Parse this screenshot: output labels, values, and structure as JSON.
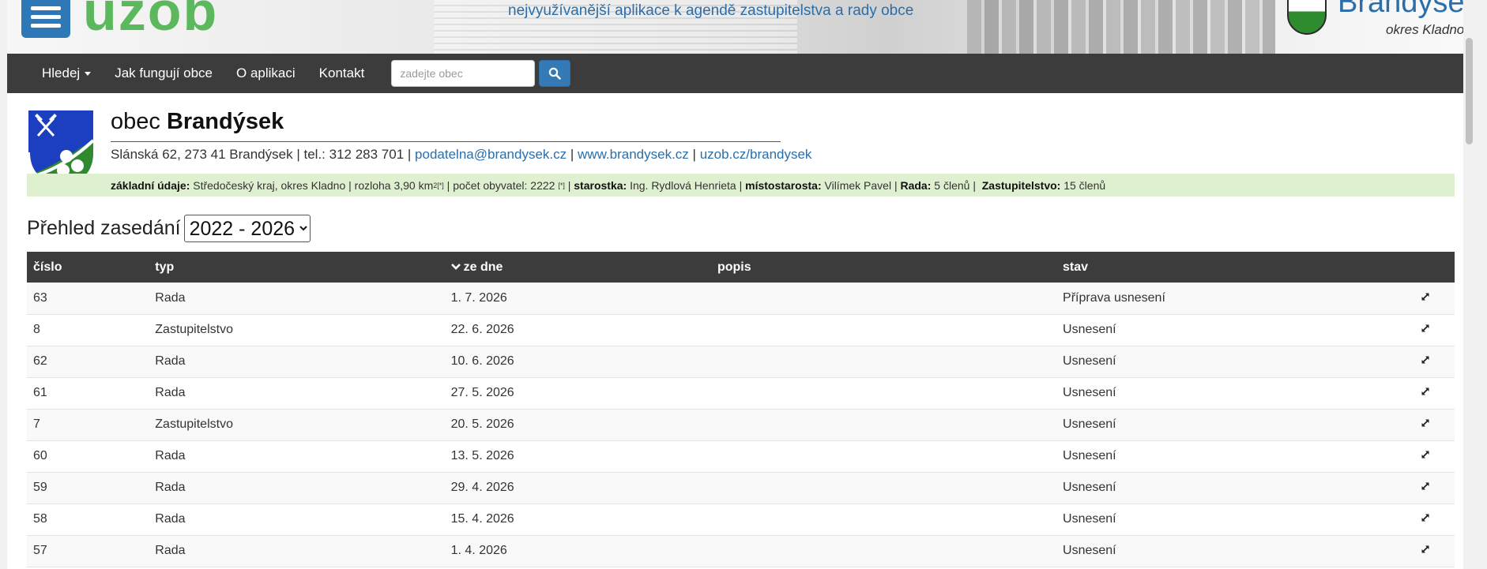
{
  "banner": {
    "logo": "uzob",
    "tagline": "nejvyužívanější aplikace k agendě zastupitelstva a rady obce",
    "municipality_short": "Brandýsek",
    "district": "okres Kladno"
  },
  "navbar": {
    "items": [
      {
        "label": "Hledej",
        "has_dropdown": true
      },
      {
        "label": "Jak fungují obce"
      },
      {
        "label": "O aplikaci"
      },
      {
        "label": "Kontakt"
      }
    ],
    "search_placeholder": "zadejte obec"
  },
  "municipality": {
    "prefix": "obec",
    "name": "Brandýsek",
    "address": "Slánská 62, 273 41 Brandýsek",
    "phone_label": "tel.:",
    "phone": "312 283 701",
    "email": "podatelna@brandysek.cz",
    "web": "www.brandysek.cz",
    "uzob_link": "uzob.cz/brandysek"
  },
  "basic_info": {
    "label": "základní údaje:",
    "region": "Středočeský kraj, okres Kladno",
    "area_label": "rozloha",
    "area": "3,90 km",
    "area_sup": "2[*]",
    "population_label": "počet obyvatel:",
    "population": "2222",
    "population_sup": "[*]",
    "mayor_label": "starostka:",
    "mayor": "Ing. Rydlová Henrieta",
    "deputy_label": "místostarosta:",
    "deputy": "Vilímek Pavel",
    "council_label": "Rada:",
    "council": "5 členů",
    "assembly_label": "Zastupitelstvo:",
    "assembly": "15 členů"
  },
  "overview": {
    "title": "Přehled zasedání",
    "period_selected": "2022 - 2026"
  },
  "table": {
    "headers": {
      "number": "číslo",
      "type": "typ",
      "date": "ze dne",
      "description": "popis",
      "status": "stav"
    },
    "rows": [
      {
        "number": "63",
        "type": "Rada",
        "date": "1. 7. 2026",
        "description": "",
        "status": "Příprava usnesení"
      },
      {
        "number": "8",
        "type": "Zastupitelstvo",
        "date": "22. 6. 2026",
        "description": "",
        "status": "Usnesení"
      },
      {
        "number": "62",
        "type": "Rada",
        "date": "10. 6. 2026",
        "description": "",
        "status": "Usnesení"
      },
      {
        "number": "61",
        "type": "Rada",
        "date": "27. 5. 2026",
        "description": "",
        "status": "Usnesení"
      },
      {
        "number": "7",
        "type": "Zastupitelstvo",
        "date": "20. 5. 2026",
        "description": "",
        "status": "Usnesení"
      },
      {
        "number": "60",
        "type": "Rada",
        "date": "13. 5. 2026",
        "description": "",
        "status": "Usnesení"
      },
      {
        "number": "59",
        "type": "Rada",
        "date": "29. 4. 2026",
        "description": "",
        "status": "Usnesení"
      },
      {
        "number": "58",
        "type": "Rada",
        "date": "15. 4. 2026",
        "description": "",
        "status": "Usnesení"
      },
      {
        "number": "57",
        "type": "Rada",
        "date": "1. 4. 2026",
        "description": "",
        "status": "Usnesení"
      }
    ]
  },
  "icons": {
    "row_action": "expand-icon",
    "sort": "chevron-down-icon",
    "search": "search-icon"
  },
  "colors": {
    "brand_green": "#5cb85c",
    "link_blue": "#2b6ea9",
    "navbar": "#3c3c3c",
    "info_band": "#dff0d0"
  }
}
